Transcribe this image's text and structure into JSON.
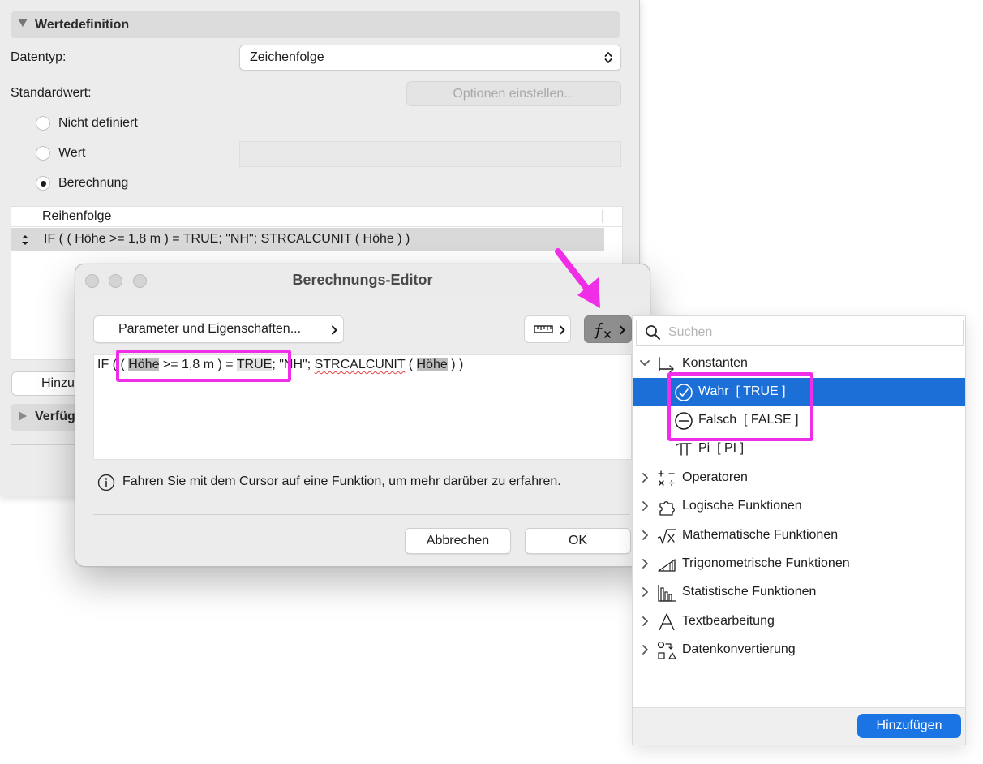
{
  "settings_panel": {
    "section_title": "Wertedefinition",
    "datentyp_label": "Datentyp:",
    "datentyp_value": "Zeichenfolge",
    "standardwert_label": "Standardwert:",
    "optionen_button": "Optionen einstellen...",
    "radio_undefined": "Nicht definiert",
    "radio_value": "Wert",
    "radio_calc": "Berechnung",
    "table_header": "Reihenfolge",
    "table_row": "IF ( ( Höhe >= 1,8 m ) = TRUE; \"NH\"; STRCALCUNIT ( Höhe ) )",
    "add_button_partial": "Hinzu",
    "collapsed_section_partial": "Verfüg"
  },
  "dialog": {
    "title": "Berechnungs-Editor",
    "param_button": "Parameter und Eigenschaften...",
    "formula": {
      "p1": "IF ",
      "p2": "( ( ",
      "p3": "Höhe",
      "p4": " >= 1,8 m ) = ",
      "p5": "TRUE",
      "p6": "; \"NH\"; ",
      "p7": "STRCALCUNIT",
      "p8": " ( ",
      "p9": "Höhe",
      "p10": " ) )"
    },
    "info_text": "Fahren Sie mit dem Cursor auf eine Funktion, um mehr darüber zu erfahren.",
    "cancel_button": "Abbrechen",
    "ok_button": "OK"
  },
  "picker": {
    "search_placeholder": "Suchen",
    "konstanten": "Konstanten",
    "wahr": "Wahr  [ TRUE ]",
    "falsch": "Falsch  [ FALSE ]",
    "pi": "Pi  [ PI ]",
    "categories": {
      "operatoren": "Operatoren",
      "logische": "Logische Funktionen",
      "mathematische": "Mathematische Funktionen",
      "trigonometrische": "Trigonometrische Funktionen",
      "statistische": "Statistische Funktionen",
      "textbearbeitung": "Textbearbeitung",
      "datenkonvertierung": "Datenkonvertierung"
    },
    "add_button": "Hinzufügen"
  },
  "colors": {
    "selection": "#1b6fd6",
    "annotation": "#f02ee8",
    "primary_button": "#1b74e4"
  }
}
